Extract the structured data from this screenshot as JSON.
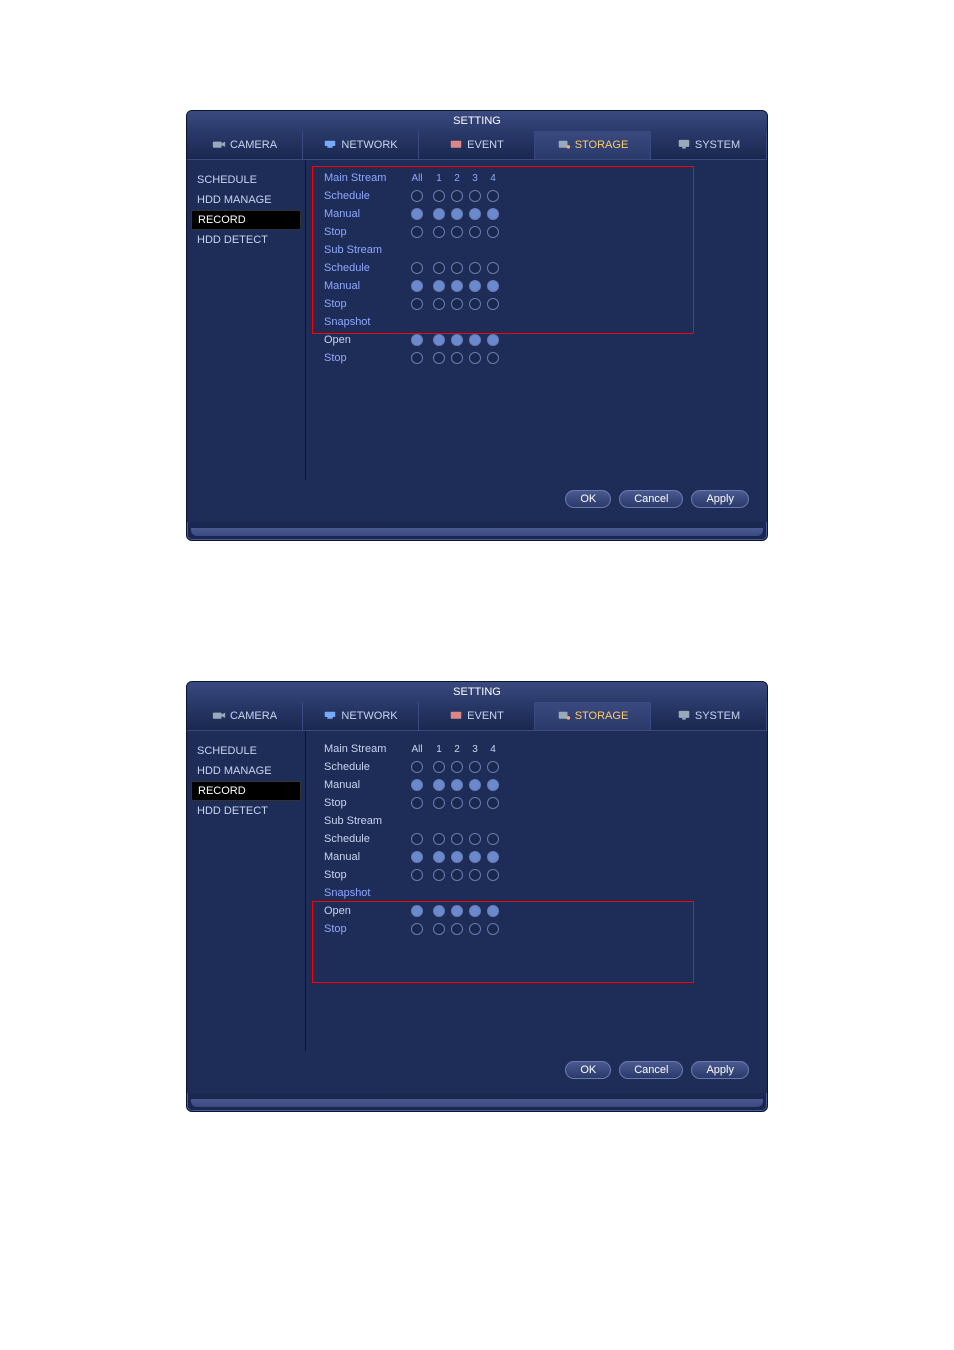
{
  "dialog_title": "SETTING",
  "tabs": {
    "camera": "CAMERA",
    "network": "NETWORK",
    "event": "EVENT",
    "storage": "STORAGE",
    "system": "SYSTEM"
  },
  "sidebar": {
    "schedule": "SCHEDULE",
    "hdd_manage": "HDD MANAGE",
    "record": "RECORD",
    "hdd_detect": "HDD DETECT"
  },
  "headers": {
    "main_stream": "Main Stream",
    "sub_stream": "Sub Stream",
    "snapshot": "Snapshot",
    "all": "All",
    "c1": "1",
    "c2": "2",
    "c3": "3",
    "c4": "4"
  },
  "rows": {
    "schedule": "Schedule",
    "manual": "Manual",
    "stop": "Stop",
    "open": "Open"
  },
  "buttons": {
    "ok": "OK",
    "cancel": "Cancel",
    "apply": "Apply"
  }
}
